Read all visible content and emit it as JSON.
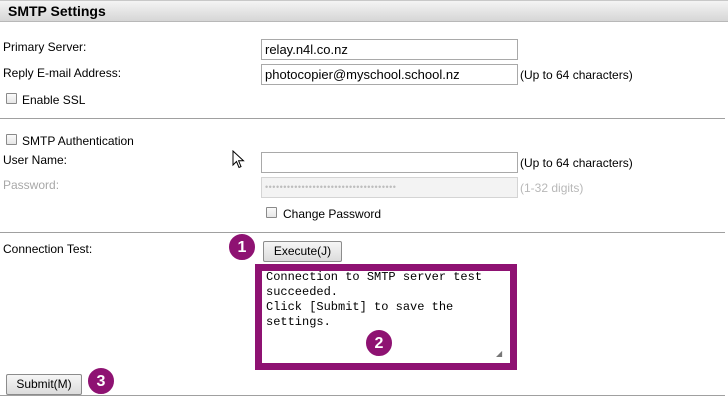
{
  "header": {
    "title": "SMTP Settings"
  },
  "primary_server": {
    "label": "Primary Server:",
    "value": "relay.n4l.co.nz"
  },
  "reply_email": {
    "label": "Reply E-mail Address:",
    "value": "photocopier@myschool.school.nz",
    "hint": "(Up to 64 characters)"
  },
  "enable_ssl": {
    "label": "Enable SSL",
    "checked": false
  },
  "smtp_auth": {
    "label": "SMTP Authentication",
    "checked": false
  },
  "user_name": {
    "label": "User Name:",
    "value": "",
    "hint": "(Up to 64 characters)"
  },
  "password": {
    "label": "Password:",
    "value": "••••••••••••••••••••••••••••••••••••",
    "hint": "(1-32 digits)"
  },
  "change_password": {
    "label": "Change Password",
    "checked": false
  },
  "connection_test": {
    "label": "Connection Test:",
    "execute_label": "Execute(J)",
    "result": "Connection to SMTP server test\nsucceeded.\nClick [Submit] to save the\nsettings."
  },
  "submit_label": "Submit(M)",
  "annotations": {
    "badge_1": "1",
    "badge_2": "2",
    "badge_3": "3",
    "color": "#8e1272"
  }
}
